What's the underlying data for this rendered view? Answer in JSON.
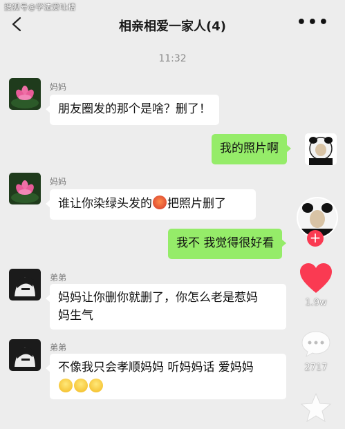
{
  "watermark": "搜狐号@学渣爱吐槽",
  "header": {
    "title": "相亲相爱一家人(4)"
  },
  "time": "11:32",
  "messages": {
    "m1": {
      "sender": "妈妈",
      "text": "朋友圈发的那个是啥？删了！"
    },
    "m2": {
      "text": "我的照片啊"
    },
    "m3": {
      "sender": "妈妈",
      "text_a": "谁让你染绿头发的",
      "text_b": "把照片删了"
    },
    "m4": {
      "text": "我不 我觉得很好看"
    },
    "m5": {
      "sender": "弟弟",
      "line1": "妈妈让你删你就删了，你怎么老是惹妈",
      "line2": "妈生气"
    },
    "m6": {
      "sender": "弟弟",
      "line1": "不像我只会孝顺妈妈 听妈妈话 爱妈妈"
    }
  },
  "side_actions": {
    "likes": "1.9w",
    "comments": "2717"
  },
  "colors": {
    "bubble_green": "#95ec69",
    "bubble_white": "#ffffff",
    "background": "#ededed",
    "like_red": "#fa3a52"
  },
  "icons": {
    "back": "chevron-left-icon",
    "more": "more-dots-icon",
    "follow": "plus-icon",
    "like": "heart-icon",
    "comment": "comment-icon",
    "favorite": "star-icon"
  }
}
